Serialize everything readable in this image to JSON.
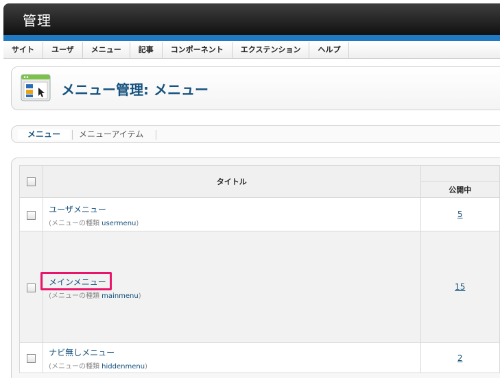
{
  "header": {
    "title": "管理",
    "bar_color": "#1f7ac3"
  },
  "menubar": {
    "items": [
      {
        "label": "サイト"
      },
      {
        "label": "ユーザ"
      },
      {
        "label": "メニュー"
      },
      {
        "label": "記事"
      },
      {
        "label": "コンポーネント"
      },
      {
        "label": "エクステンション"
      },
      {
        "label": "ヘルプ"
      }
    ]
  },
  "toolbar": {
    "title": "メニュー管理: メニュー",
    "icon": "menu-manager-icon"
  },
  "submenu": {
    "tabs": [
      {
        "label": "メニュー",
        "active": true
      },
      {
        "label": "メニューアイテム",
        "active": false
      }
    ]
  },
  "table": {
    "headers": {
      "title": "タイトル",
      "published": "公開中"
    },
    "rows": [
      {
        "name": "ユーザメニュー",
        "type_prefix": "(メニューの種類",
        "type_code": "usermenu",
        "type_suffix": ")",
        "published": "5"
      },
      {
        "name": "メインメニュー",
        "type_prefix": "(メニューの種類",
        "type_code": "mainmenu",
        "type_suffix": ")",
        "published": "15",
        "highlighted": true
      },
      {
        "name": "ナビ無しメニュー",
        "type_prefix": "(メニューの種類",
        "type_code": "hiddenmenu",
        "type_suffix": ")",
        "published": "2"
      }
    ]
  },
  "colors": {
    "link": "#15527e",
    "highlight": "#e8156a"
  }
}
